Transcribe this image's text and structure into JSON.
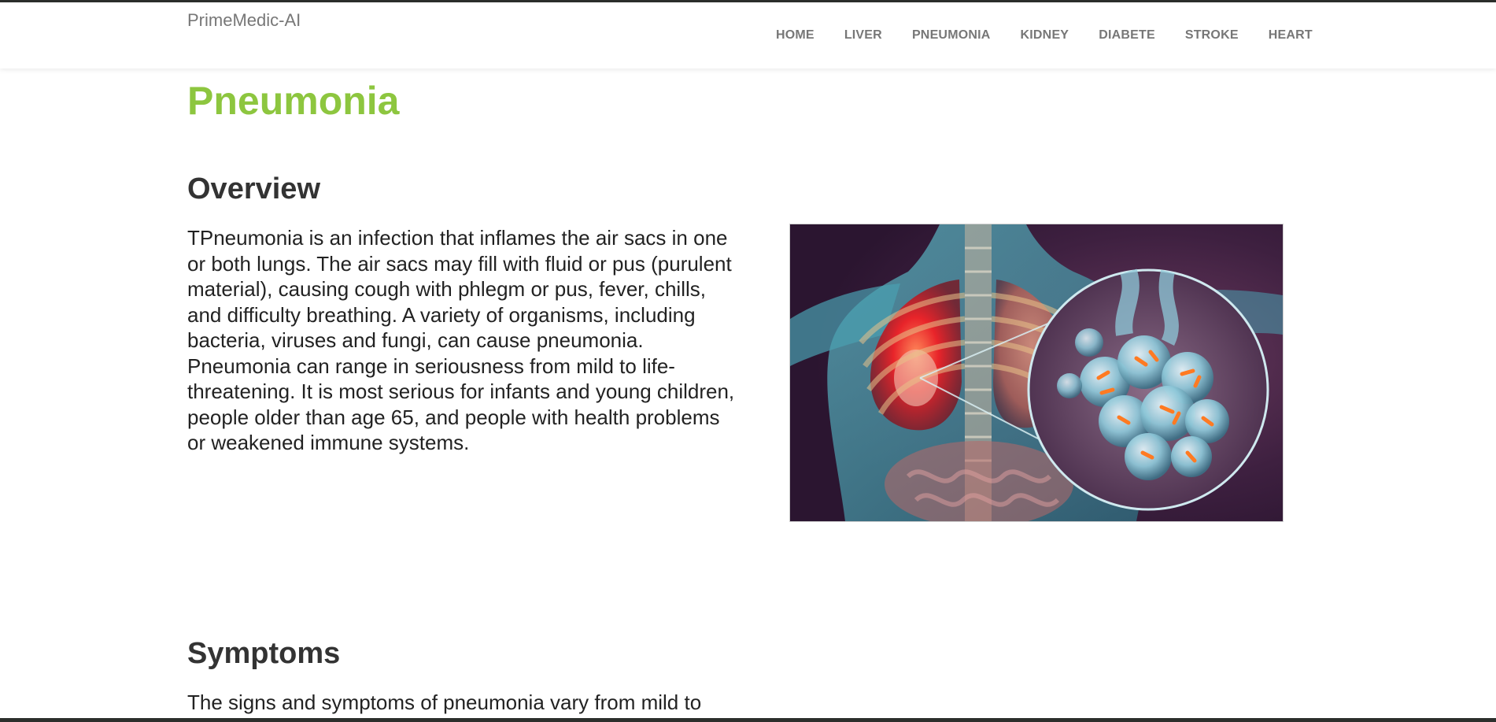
{
  "header": {
    "brand": "PrimeMedic-AI",
    "nav": [
      {
        "label": "HOME"
      },
      {
        "label": "LIVER"
      },
      {
        "label": "PNEUMONIA"
      },
      {
        "label": "KIDNEY"
      },
      {
        "label": "DIABETE"
      },
      {
        "label": "STROKE"
      },
      {
        "label": "HEART"
      }
    ]
  },
  "main": {
    "title": "Pneumonia",
    "overview": {
      "heading": "Overview",
      "text": "TPneumonia is an infection that inflames the air sacs in one or both lungs. The air sacs may fill with fluid or pus (purulent material), causing cough with phlegm or pus, fever, chills, and difficulty breathing. A variety of organisms, including bacteria, viruses and fungi, can cause pneumonia. Pneumonia can range in seriousness from mild to life-threatening. It is most serious for infants and young children, people older than age 65, and people with health problems or weakened immune systems."
    },
    "symptoms": {
      "heading": "Symptoms",
      "text": "The signs and symptoms of pneumonia vary from mild to"
    }
  },
  "colors": {
    "title_green": "#8dc63f",
    "nav_text": "#777777",
    "heading_text": "#333333",
    "figure_background": "#341a33"
  }
}
